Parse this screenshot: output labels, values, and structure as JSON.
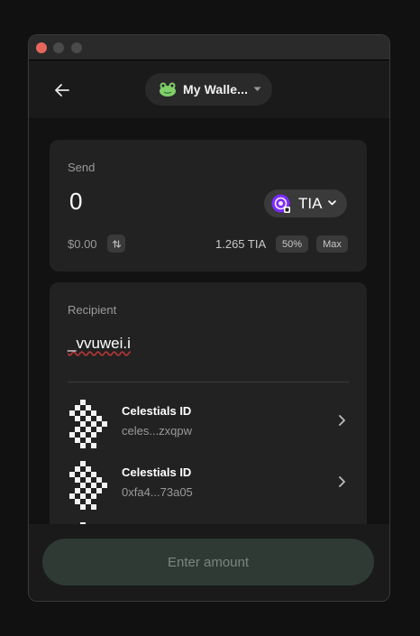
{
  "header": {
    "wallet_name": "My Walle..."
  },
  "send": {
    "label": "Send",
    "amount": "0",
    "token": "TIA",
    "usd_value": "$0.00",
    "balance": "1.265 TIA",
    "pct_label": "50%",
    "max_label": "Max"
  },
  "recipient": {
    "label": "Recipient",
    "value": "_vvuwei.i",
    "results": [
      {
        "name": "Celestials ID",
        "address": "celes...zxqpw"
      },
      {
        "name": "Celestials ID",
        "address": "0xfa4...73a05"
      }
    ]
  },
  "footer": {
    "submit_label": "Enter amount"
  },
  "colors": {
    "background": "#111111",
    "card": "#222222",
    "submit_button": "#2e3a33",
    "traffic_close": "#e5675c"
  },
  "icons": [
    "back-arrow-icon",
    "frog-icon",
    "caret-down-icon",
    "tia-token-icon",
    "chevron-down-icon",
    "swap-icon",
    "chevron-right-icon",
    "pixel-avatar-icon"
  ]
}
